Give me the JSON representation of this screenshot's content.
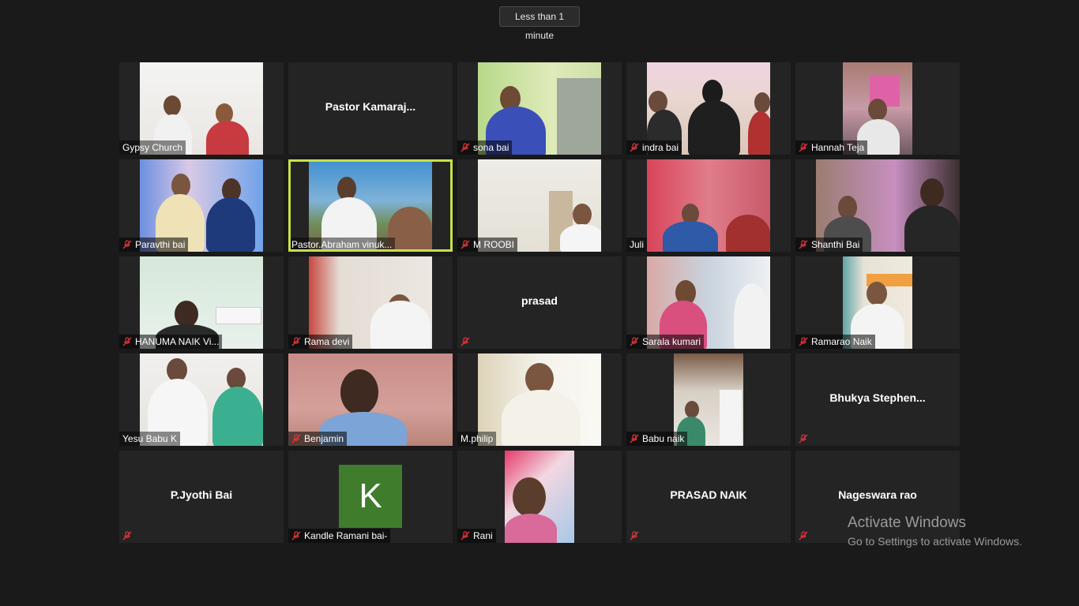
{
  "meeting": {
    "timer_label": "Less than 1 minute"
  },
  "participants": [
    {
      "name": "Gypsy Church",
      "muted": false,
      "display": "video"
    },
    {
      "name": "Pastor  Kamaraj...",
      "muted": false,
      "display": "name"
    },
    {
      "name": "sona bai",
      "muted": true,
      "display": "video"
    },
    {
      "name": "indra bai",
      "muted": true,
      "display": "video"
    },
    {
      "name": "Hannah Teja",
      "muted": true,
      "display": "video"
    },
    {
      "name": "Paravthi bai",
      "muted": true,
      "display": "video"
    },
    {
      "name": "Pastor.Abraham vinuk...",
      "muted": false,
      "display": "video",
      "active_speaker": true
    },
    {
      "name": "M ROOBI",
      "muted": true,
      "display": "video"
    },
    {
      "name": "Juli",
      "muted": false,
      "display": "video"
    },
    {
      "name": "Shanthi Bai",
      "muted": true,
      "display": "video"
    },
    {
      "name": "HANUMA NAIK Vi...",
      "muted": true,
      "display": "video"
    },
    {
      "name": "Rama devi",
      "muted": true,
      "display": "video"
    },
    {
      "name": "prasad",
      "muted": true,
      "display": "name"
    },
    {
      "name": "Sarala kumari",
      "muted": true,
      "display": "video"
    },
    {
      "name": "Ramarao Naik",
      "muted": true,
      "display": "video"
    },
    {
      "name": "Yesu Babu K",
      "muted": false,
      "display": "video"
    },
    {
      "name": "Benjamin",
      "muted": true,
      "display": "video"
    },
    {
      "name": "M.philip",
      "muted": false,
      "display": "video"
    },
    {
      "name": "Babu naik",
      "muted": true,
      "display": "video"
    },
    {
      "name": "Bhukya  Stephen...",
      "muted": true,
      "display": "name"
    },
    {
      "name": "P.Jyothi Bai",
      "muted": true,
      "display": "name"
    },
    {
      "name": "Kandle Ramani bai-",
      "muted": true,
      "display": "avatar",
      "initial": "K"
    },
    {
      "name": "Rani",
      "muted": true,
      "display": "video"
    },
    {
      "name": "PRASAD NAIK",
      "muted": true,
      "display": "name"
    },
    {
      "name": "Nageswara rao",
      "muted": true,
      "display": "name"
    }
  ],
  "watermark": {
    "title": "Activate Windows",
    "subtitle": "Go to Settings to activate Windows."
  },
  "colors": {
    "background": "#1a1a1a",
    "tile": "#242424",
    "active_border": "#c8e04a",
    "mute_red": "#e0363b",
    "avatar_green": "#3f7d2c"
  }
}
